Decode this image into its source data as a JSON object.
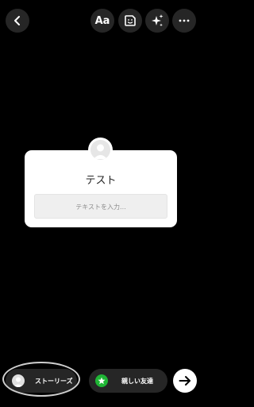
{
  "toolbar": {
    "text_button_label": "Aa",
    "icons": [
      "chevron-left-icon",
      "sticker-icon",
      "sparkles-icon",
      "more-horizontal-icon"
    ]
  },
  "question_card": {
    "title": "テスト",
    "input_placeholder": "テキストを入力..."
  },
  "bottom_bar": {
    "stories_label": "ストーリーズ",
    "close_friends_label": "親しい友達"
  },
  "colors": {
    "background": "#000000",
    "button_bg": "#262626",
    "close_friends_green": "#1fb535",
    "card_bg": "#ffffff"
  }
}
